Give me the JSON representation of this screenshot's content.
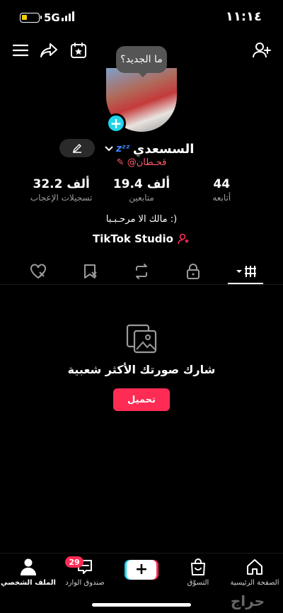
{
  "status_bar": {
    "network": "5G",
    "time": "١١:١٤",
    "battery_color": "#f5d000"
  },
  "top_actions": {
    "icons": [
      "menu-icon",
      "share-icon",
      "calendar-star-icon",
      "add-friend-icon"
    ]
  },
  "profile": {
    "tooltip": "ما الجديد؟",
    "display_name": "السسعدي",
    "sleep_emoji": "zᶻᶻ",
    "username": "@قحـطان",
    "bio": "مالك الا مرحـبـبا :)",
    "studio_label": "TikTok Studio"
  },
  "stats": [
    {
      "value": "44",
      "label": "أتابعه"
    },
    {
      "value": "19.4 ألف",
      "label": "متابعين"
    },
    {
      "value": "32.2 ألف",
      "label": "تسجيلات الإعجاب"
    }
  ],
  "tabs": [
    "videos-grid-icon",
    "lock-icon",
    "repost-icon",
    "favorites-icon",
    "liked-icon"
  ],
  "empty_state": {
    "title": "شارك صورتك الأكثر شعبية",
    "button": "تحميل"
  },
  "bottom_nav": {
    "home": "الصفحة الرئيسية",
    "shop": "التسوّق",
    "create": "+",
    "inbox": "صندوق الوارد",
    "inbox_badge": "29",
    "profile": "الملف الشخصي"
  },
  "watermark": "حراج",
  "colors": {
    "accent": "#fe2c55",
    "cyan": "#20d5ec",
    "username": "#ff5a6e"
  }
}
